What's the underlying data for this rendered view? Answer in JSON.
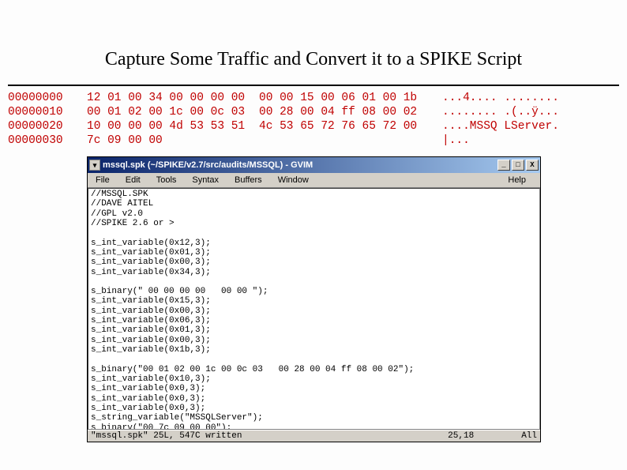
{
  "title": "Capture Some Traffic and Convert it to a SPIKE Script",
  "hex": {
    "rows": [
      {
        "offset": "00000000",
        "b1": "12 01 00 34 00 00 00 00",
        "b2": "00 00 15 00 06 01 00 1b",
        "ascii": "...4.... ........"
      },
      {
        "offset": "00000010",
        "b1": "00 01 02 00 1c 00 0c 03",
        "b2": "00 28 00 04 ff 08 00 02",
        "ascii": "........ .(..ÿ..."
      },
      {
        "offset": "00000020",
        "b1": "10 00 00 00 4d 53 53 51",
        "b2": "4c 53 65 72 76 65 72 00",
        "ascii": "....MSSQ LServer."
      },
      {
        "offset": "00000030",
        "b1": "7c 09 00 00",
        "b2": "",
        "ascii": "|..."
      }
    ]
  },
  "window": {
    "title": "mssql.spk (~/SPIKE/v2.7/src/audits/MSSQL) - GVIM",
    "menu": [
      "File",
      "Edit",
      "Tools",
      "Syntax",
      "Buffers",
      "Window"
    ],
    "menu_help": "Help",
    "status_file": "\"mssql.spk\" 25L, 547C written",
    "status_pos": "25,18",
    "status_mode": "All",
    "buttons": {
      "min": "_",
      "max": "□",
      "close": "X"
    },
    "content": "//MSSQL.SPK\n//DAVE AITEL\n//GPL v2.0\n//SPIKE 2.6 or >\n\ns_int_variable(0x12,3);\ns_int_variable(0x01,3);\ns_int_variable(0x00,3);\ns_int_variable(0x34,3);\n\ns_binary(\" 00 00 00 00   00 00 \");\ns_int_variable(0x15,3);\ns_int_variable(0x00,3);\ns_int_variable(0x06,3);\ns_int_variable(0x01,3);\ns_int_variable(0x00,3);\ns_int_variable(0x1b,3);\n\ns_binary(\"00 01 02 00 1c 00 0c 03   00 28 00 04 ff 08 00 02\");\ns_int_variable(0x10,3);\ns_int_variable(0x0,3);\ns_int_variable(0x0,3);\ns_int_variable(0x0,3);\ns_string_variable(\"MSSQLServer\");\ns_binary(\"00 7c 09 00 00\");"
  }
}
